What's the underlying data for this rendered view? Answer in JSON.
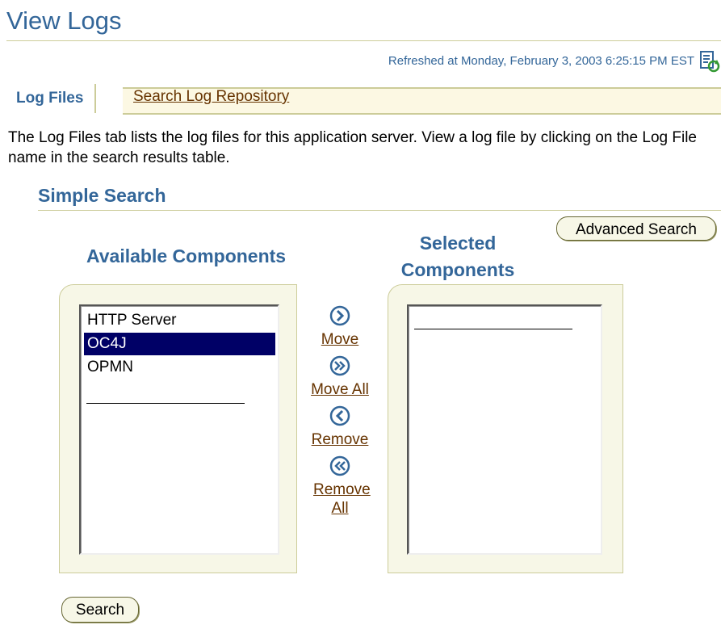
{
  "page": {
    "title": "View Logs",
    "refreshed": "Refreshed at Monday, February 3, 2003 6:25:15 PM EST",
    "refresh_icon": "refresh-icon"
  },
  "tabs": [
    {
      "label": "Log Files",
      "active": true
    },
    {
      "label": "Search Log Repository",
      "active": false
    }
  ],
  "intro_text": "The Log Files tab lists the log files for this application server. View a log file by clicking on the Log File name in the search results table.",
  "search": {
    "section_title": "Simple Search",
    "advanced_button": "Advanced Search",
    "search_button": "Search",
    "available_label": "Available Components",
    "selected_label": "Selected Components",
    "available_items": [
      "HTTP Server",
      "OC4J",
      "OPMN"
    ],
    "selected_available_item": "OC4J",
    "controls": {
      "move": "Move",
      "move_all": "Move All",
      "remove": "Remove",
      "remove_all": "Remove All"
    }
  },
  "colors": {
    "heading": "#336699",
    "link": "#663300",
    "selection": "#000066",
    "frame": "#f7f7e7"
  }
}
